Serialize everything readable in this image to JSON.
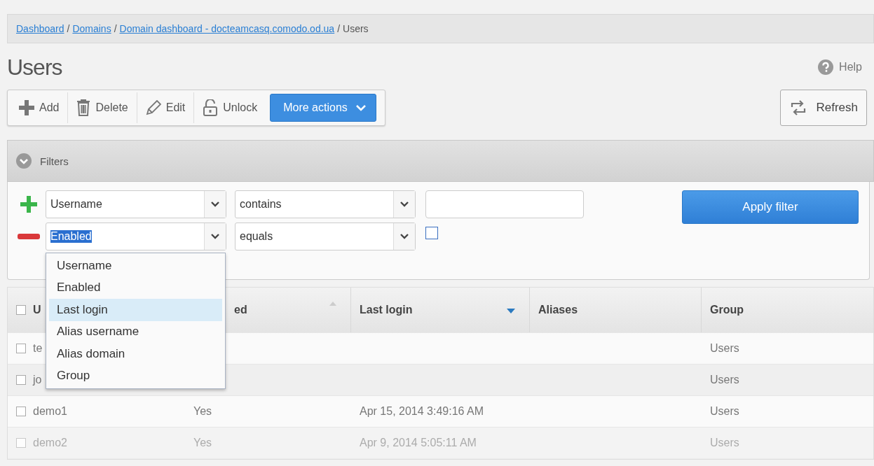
{
  "breadcrumb": {
    "links": [
      "Dashboard",
      "Domains",
      "Domain dashboard - docteamcasq.comodo.od.ua"
    ],
    "separator": "/",
    "current": "Users"
  },
  "page_title": "Users",
  "help": "Help",
  "toolbar": [
    {
      "kind": "add",
      "label": "Add"
    },
    {
      "kind": "delete",
      "label": "Delete"
    },
    {
      "kind": "edit",
      "label": "Edit"
    },
    {
      "kind": "unlock",
      "label": "Unlock"
    },
    {
      "kind": "more",
      "label": "More actions"
    }
  ],
  "refresh": "Refresh",
  "filters": {
    "title": "Filters",
    "expanded": true,
    "apply": "Apply filter",
    "rows": [
      {
        "kind": "add",
        "field": "Username",
        "field_highlighted": false,
        "operator": "contains",
        "value": ""
      },
      {
        "kind": "remove",
        "field": "Enabled",
        "field_highlighted": true,
        "operator": "equals",
        "checked": false
      }
    ],
    "dropdown": [
      {
        "label": "Username",
        "selected": false
      },
      {
        "label": "Enabled",
        "selected": false
      },
      {
        "label": "Last login",
        "selected": true
      },
      {
        "label": "Alias username",
        "selected": false
      },
      {
        "label": "Alias domain",
        "selected": false
      },
      {
        "label": "Group",
        "selected": false
      }
    ]
  },
  "table": {
    "all_checked": false,
    "columns": [
      {
        "label": "U"
      },
      {
        "label": "ed",
        "sorted": true,
        "descending": false
      },
      {
        "label": "Last login",
        "sorted": true,
        "descending": true
      },
      {
        "label": "Aliases"
      },
      {
        "label": "Group"
      }
    ],
    "rows": [
      {
        "checked": false,
        "cells": [
          "te",
          "",
          "",
          "",
          "Users"
        ]
      },
      {
        "checked": false,
        "cells": [
          "jo",
          "",
          "",
          "",
          "Users"
        ]
      },
      {
        "checked": false,
        "cells": [
          "demo1",
          "Yes",
          "Apr 15, 2014 3:49:16 AM",
          "",
          "Users"
        ]
      },
      {
        "checked": false,
        "cells": [
          "demo2",
          "Yes",
          "Apr 9, 2014 5:05:11 AM",
          "",
          "Users"
        ]
      }
    ]
  }
}
